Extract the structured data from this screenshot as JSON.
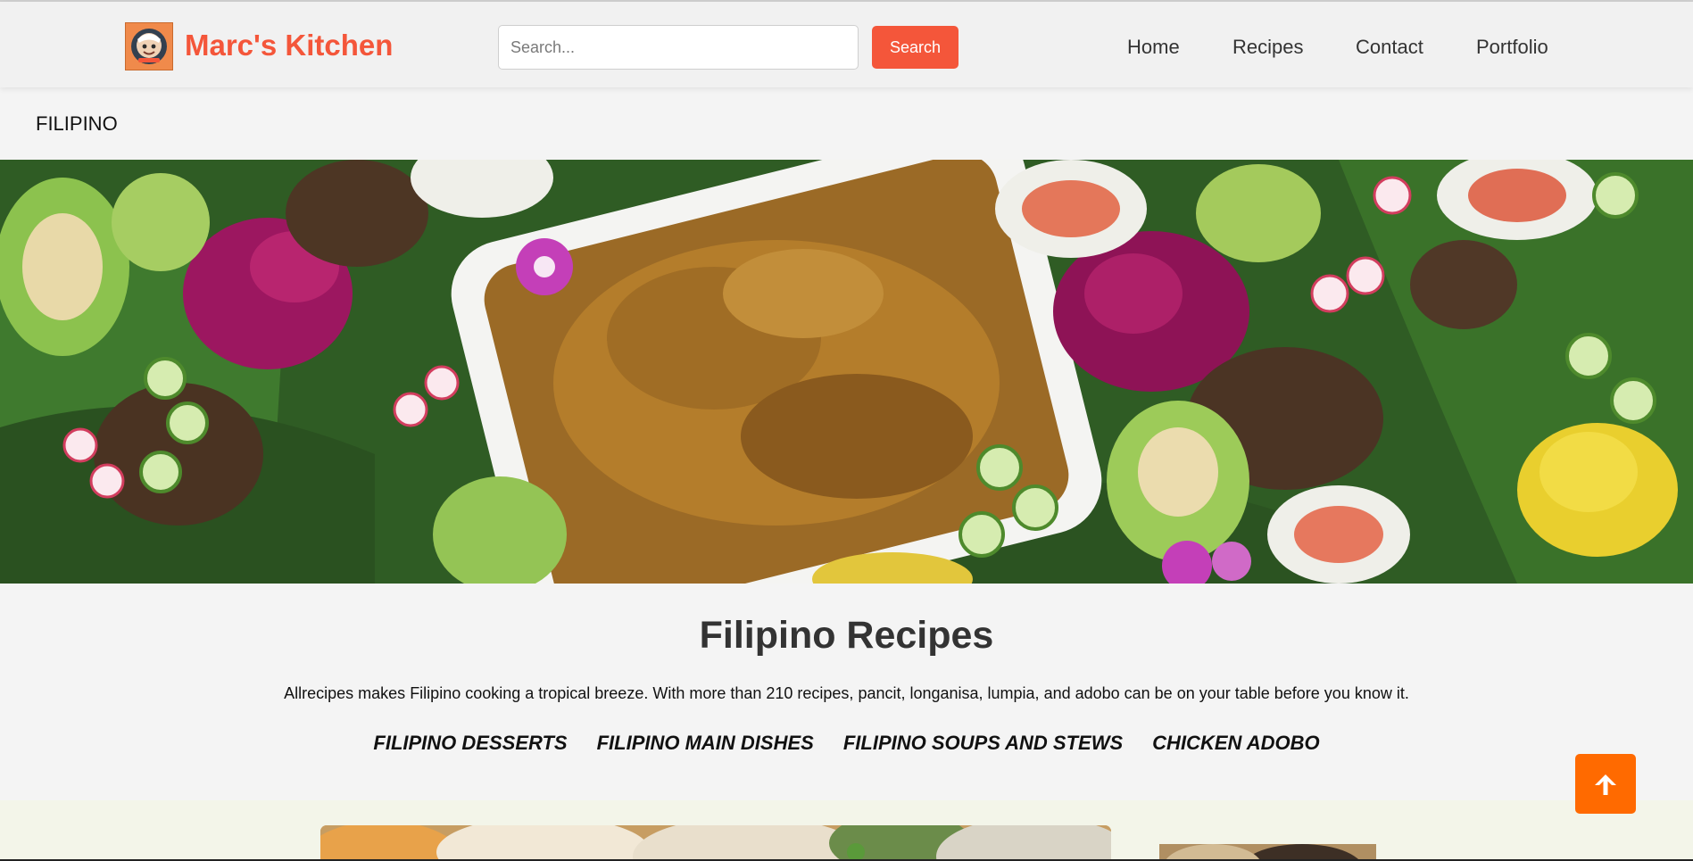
{
  "header": {
    "brand": "Marc's Kitchen",
    "logo_icon": "chef-avatar-icon",
    "search_placeholder": "Search...",
    "search_value": "",
    "search_button_label": "Search",
    "nav": [
      {
        "label": "Home"
      },
      {
        "label": "Recipes"
      },
      {
        "label": "Contact"
      },
      {
        "label": "Portfolio"
      }
    ]
  },
  "breadcrumb": "FILIPINO",
  "hero": {
    "image_alt": "Filipino food spread on banana leaves"
  },
  "intro": {
    "title": "Filipino Recipes",
    "description": "Allrecipes makes Filipino cooking a tropical breeze. With more than 210 recipes, pancit, longanisa, lumpia, and adobo can be on your table before you know it."
  },
  "categories": [
    {
      "label": "FILIPINO DESSERTS"
    },
    {
      "label": "FILIPINO MAIN DISHES"
    },
    {
      "label": "FILIPINO SOUPS AND STEWS"
    },
    {
      "label": "CHICKEN ADOBO"
    }
  ],
  "back_to_top": {
    "icon": "arrow-up-icon"
  },
  "colors": {
    "accent": "#f4563a",
    "back_to_top": "#ff6a00",
    "page_background": "#f4f4f4",
    "card_band_background": "#f3f5e9"
  }
}
